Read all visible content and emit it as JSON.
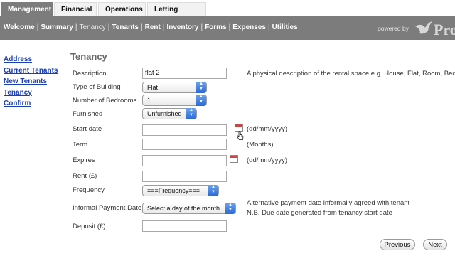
{
  "tabs": [
    "Management",
    "Financial",
    "Operations",
    "Letting Agents"
  ],
  "subnav": {
    "links": [
      "Welcome",
      "Summary",
      "Tenancy",
      "Tenants",
      "Rent",
      "Inventory",
      "Forms",
      "Expenses",
      "Utilities"
    ],
    "separator": "|",
    "powered_by": "powered by",
    "logo_text": "Pro"
  },
  "sidebar": [
    "Address",
    "Current Tenants",
    "New Tenants",
    "Tenancy",
    "Confirm"
  ],
  "form": {
    "heading": "Tenancy",
    "description": {
      "label": "Description",
      "value": "flat 2",
      "help": "A physical description of the rental space e.g. House, Flat, Room, Bed"
    },
    "type_of_building": {
      "label": "Type of Building",
      "value": "Flat"
    },
    "number_of_bedrooms": {
      "label": "Number of Bedrooms",
      "value": "1"
    },
    "furnished": {
      "label": "Furnished",
      "value": "Unfurnished"
    },
    "start_date": {
      "label": "Start date",
      "value": "",
      "help": "(dd/mm/yyyy)"
    },
    "term": {
      "label": "Term",
      "value": "",
      "help": "(Months)"
    },
    "expires": {
      "label": "Expires",
      "value": "",
      "help": "(dd/mm/yyyy)"
    },
    "rent": {
      "label": "Rent (£)",
      "value": ""
    },
    "frequency": {
      "label": "Frequency",
      "value": "===Frequency==="
    },
    "informal_payment_date": {
      "label": "Informal Payment Date",
      "value": "Select a day of the month",
      "help_1": "Alternative payment date informally agreed with tenant",
      "help_2": "N.B. Due date generated from tenancy start date"
    },
    "deposit": {
      "label": "Deposit (£)",
      "value": ""
    }
  },
  "buttons": {
    "previous": "Previous",
    "next": "Next"
  },
  "colors": {
    "nav_bar": "#7c7c7c",
    "link": "#1a3fb0",
    "select_arrow": "#2968d6"
  }
}
